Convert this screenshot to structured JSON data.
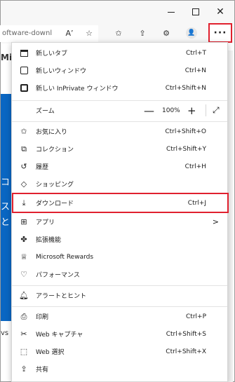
{
  "toolbar": {
    "address_text": "oftware-downl",
    "read_aloud_icon": "A’",
    "more_label": "···"
  },
  "page": {
    "title_fragment": "Mic",
    "blue_fragments": [
      "コ",
      "ス",
      "と"
    ],
    "ws_fragment": "vs"
  },
  "menu": {
    "new_tab": {
      "label": "新しいタブ",
      "shortcut": "Ctrl+T"
    },
    "new_window": {
      "label": "新しいウィンドウ",
      "shortcut": "Ctrl+N"
    },
    "new_inprivate": {
      "label": "新しい InPrivate ウィンドウ",
      "shortcut": "Ctrl+Shift+N"
    },
    "zoom": {
      "label": "ズーム",
      "minus": "—",
      "value": "100%",
      "plus": "+"
    },
    "favorites": {
      "label": "お気に入り",
      "shortcut": "Ctrl+Shift+O"
    },
    "collections": {
      "label": "コレクション",
      "shortcut": "Ctrl+Shift+Y"
    },
    "history": {
      "label": "履歴",
      "shortcut": "Ctrl+H"
    },
    "shopping": {
      "label": "ショッピング"
    },
    "downloads": {
      "label": "ダウンロード",
      "shortcut": "Ctrl+J"
    },
    "apps": {
      "label": "アプリ",
      "arrow": ">"
    },
    "extensions": {
      "label": "拡張機能"
    },
    "rewards": {
      "label": "Microsoft Rewards"
    },
    "performance": {
      "label": "パフォーマンス"
    },
    "alerts": {
      "label": "アラートとヒント"
    },
    "print": {
      "label": "印刷",
      "shortcut": "Ctrl+P"
    },
    "web_capture": {
      "label": "Web キャプチャ",
      "shortcut": "Ctrl+Shift+S"
    },
    "web_select": {
      "label": "Web 選択",
      "shortcut": "Ctrl+Shift+X"
    },
    "share": {
      "label": "共有"
    }
  },
  "colors": {
    "highlight": "#e0202e",
    "page_blue": "#0a66c2"
  }
}
